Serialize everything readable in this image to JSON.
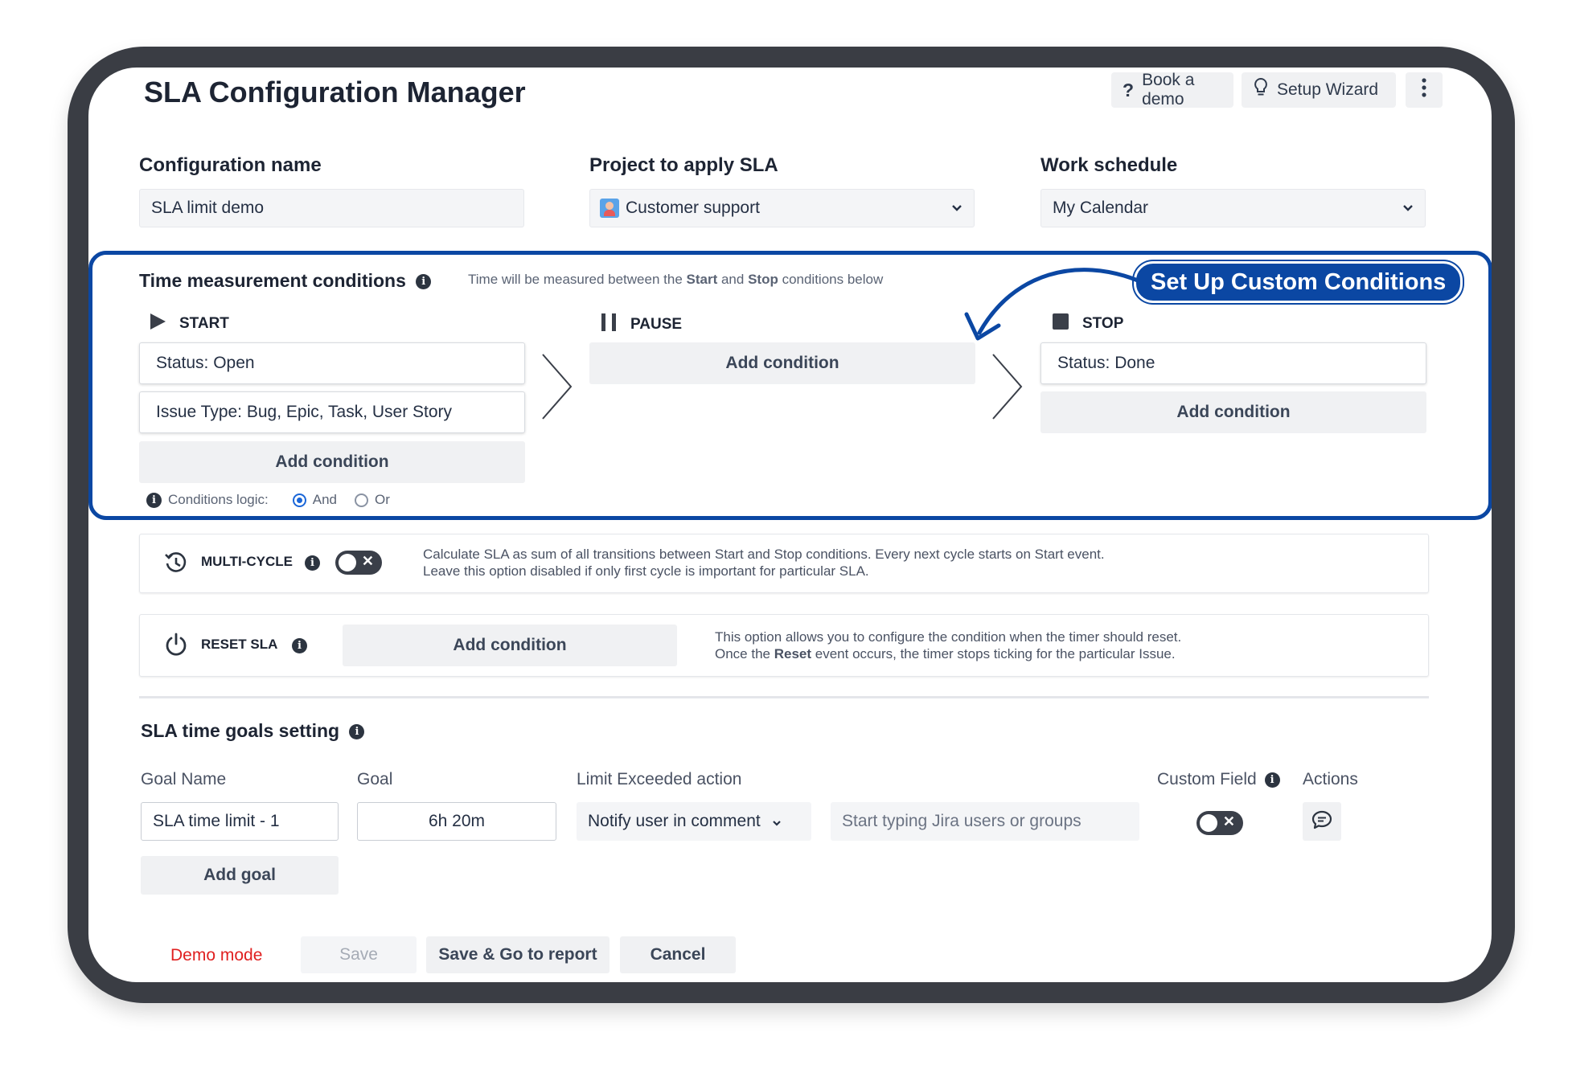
{
  "app": {
    "title": "SLA Configuration Manager",
    "book_demo_label": "Book a demo",
    "setup_wizard_label": "Setup Wizard"
  },
  "config": {
    "name_label": "Configuration name",
    "name_value": "SLA limit demo",
    "project_label": "Project to apply SLA",
    "project_value": "Customer support",
    "schedule_label": "Work schedule",
    "schedule_value": "My Calendar"
  },
  "callout": {
    "text": "Set Up Custom Conditions",
    "color": "#0b47a3"
  },
  "time_conditions": {
    "heading": "Time measurement conditions",
    "hint_prefix": "Time will be measured between the ",
    "hint_start": "Start",
    "hint_and": " and ",
    "hint_stop": "Stop",
    "hint_suffix": " conditions below",
    "start": {
      "label": "START",
      "conditions": [
        "Status: Open",
        "Issue Type: Bug, Epic, Task, User Story"
      ],
      "add_label": "Add condition"
    },
    "pause": {
      "label": "PAUSE",
      "add_label": "Add condition"
    },
    "stop": {
      "label": "STOP",
      "conditions": [
        "Status: Done"
      ],
      "add_label": "Add condition"
    },
    "logic_label": "Conditions logic:",
    "logic_and": "And",
    "logic_or": "Or",
    "logic_selected": "And"
  },
  "multi_cycle": {
    "label": "MULTI-CYCLE",
    "enabled": false,
    "desc_line1": "Calculate SLA as sum of all transitions between Start and Stop conditions. Every next cycle starts on Start event.",
    "desc_line2": "Leave this option disabled if only first cycle is important for particular SLA."
  },
  "reset_sla": {
    "label": "RESET SLA",
    "add_label": "Add condition",
    "desc_line1": "This option allows you to configure the condition when the timer should reset.",
    "desc_line2_prefix": "Once the ",
    "desc_line2_bold": "Reset",
    "desc_line2_suffix": " event occurs, the timer stops ticking for the particular Issue."
  },
  "goals": {
    "heading": "SLA time goals setting",
    "columns": [
      "Goal Name",
      "Goal",
      "Limit Exceeded action",
      "Custom Field",
      "Actions"
    ],
    "rows": [
      {
        "name": "SLA time limit - 1",
        "goal": "6h 20m",
        "action": "Notify user in comment",
        "users_placeholder": "Start typing Jira users or groups",
        "custom_field": false
      }
    ],
    "add_goal_label": "Add goal"
  },
  "footer": {
    "demo_mode": "Demo mode",
    "save": "Save",
    "save_report": "Save & Go to report",
    "cancel": "Cancel"
  }
}
